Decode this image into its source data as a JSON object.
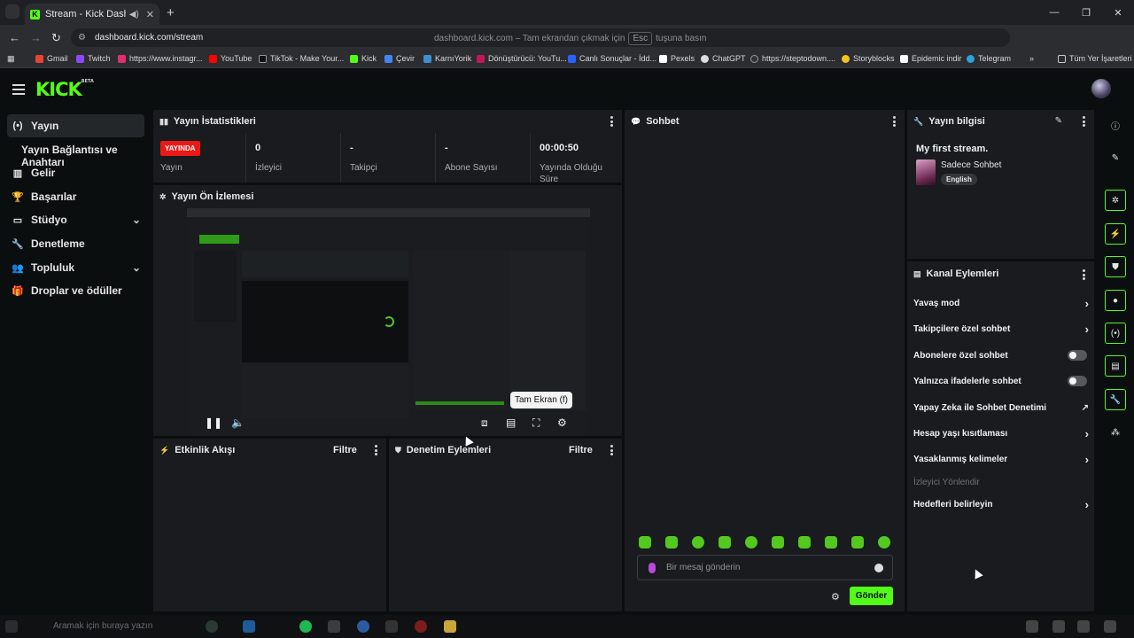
{
  "browser": {
    "tab_title": "Stream - Kick Dashboard",
    "url": "dashboard.kick.com/stream",
    "fullscreen_hint_prefix": "dashboard.kick.com – Tam ekrandan çıkmak için",
    "fullscreen_hint_key": "Esc",
    "fullscreen_hint_suffix": "tuşuna basın",
    "bookmarks": [
      "Gmail",
      "Twitch",
      "https://www.instagr...",
      "YouTube",
      "TikTok - Make Your...",
      "Kick",
      "Çevir",
      "KarnıYorik",
      "Dönüştürücü: YouTu...",
      "Canlı Sonuçlar - İdd...",
      "Pexels",
      "ChatGPT",
      "https://steptodown....",
      "Storyblocks",
      "Epidemic indir",
      "Telegram"
    ],
    "all_bookmarks": "Tüm Yer İşaretleri"
  },
  "brand": {
    "logo": "KICK",
    "beta": "BETA",
    "accent": "#53fc18"
  },
  "sidebar": {
    "items": [
      {
        "label": "Yayın"
      },
      {
        "label": "Yayın Bağlantısı ve Anahtarı"
      },
      {
        "label": "Gelir"
      },
      {
        "label": "Başarılar"
      },
      {
        "label": "Stüdyo"
      },
      {
        "label": "Denetleme"
      },
      {
        "label": "Topluluk"
      },
      {
        "label": "Droplar ve ödüller"
      }
    ]
  },
  "stats": {
    "title": "Yayın İstatistikleri",
    "live_badge": "YAYINDA",
    "live_label": "Yayın",
    "viewers_value": "0",
    "viewers_label": "İzleyici",
    "followers_value": "-",
    "followers_label": "Takipçi",
    "subs_value": "-",
    "subs_label": "Abone Sayısı",
    "uptime_value": "00:00:50",
    "uptime_label_1": "Yayında Olduğu",
    "uptime_label_2": "Süre"
  },
  "preview": {
    "title": "Yayın Ön İzlemesi",
    "tooltip": "Tam Ekran (f)"
  },
  "activity": {
    "title": "Etkinlik Akışı",
    "filter": "Filtre"
  },
  "moderation": {
    "title": "Denetim Eylemleri",
    "filter": "Filtre"
  },
  "chat": {
    "title": "Sohbet",
    "placeholder": "Bir mesaj gönderin",
    "send": "Gönder"
  },
  "info": {
    "title": "Yayın bilgisi",
    "stream_title": "My first stream.",
    "category": "Sadece Sohbet",
    "language": "English"
  },
  "channel_actions": {
    "title": "Kanal Eylemleri",
    "items": [
      "Yavaş mod",
      "Takipçilere özel sohbet",
      "Abonelere özel sohbet",
      "Yalnızca ifadelerle sohbet",
      "Yapay Zeka ile Sohbet Denetimi",
      "Hesap yaşı kısıtlaması",
      "Yasaklanmış kelimeler",
      "İzleyici Yönlendir",
      "Hedefleri belirleyin"
    ]
  },
  "taskbar": {
    "search": "Aramak için buraya yazın"
  }
}
